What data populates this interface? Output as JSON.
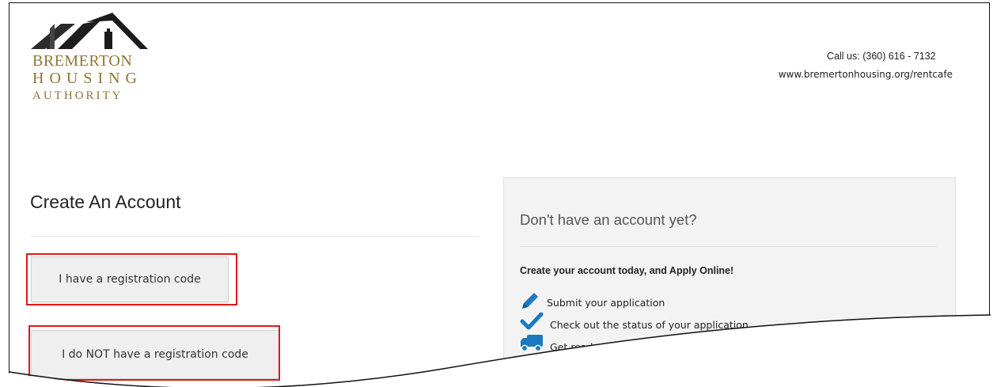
{
  "header": {
    "logo": {
      "line1": "BREMERTON",
      "line2": "HOUSING",
      "line3": "AUTHORITY"
    },
    "contact": {
      "phone": "Call us: (360) 616 - 7132",
      "url": "www.bremertonhousing.org/rentcafe"
    }
  },
  "left": {
    "title": "Create An Account",
    "buttons": {
      "has_code": "I have a registration code",
      "no_code": "I do NOT have a registration code"
    }
  },
  "panel": {
    "title": "Don't have an account yet?",
    "lead": "Create your account today, and Apply Online!",
    "features": [
      {
        "label": "Submit your application",
        "icon": "pencil-icon"
      },
      {
        "label": "Check out the status of your application",
        "icon": "checkmark-icon"
      },
      {
        "label": "Get ready to move in!",
        "icon": "truck-icon"
      }
    ]
  },
  "colors": {
    "brand_gold": "#8e7634",
    "icon_blue": "#1b79c0",
    "highlight_red": "#e0161b"
  }
}
